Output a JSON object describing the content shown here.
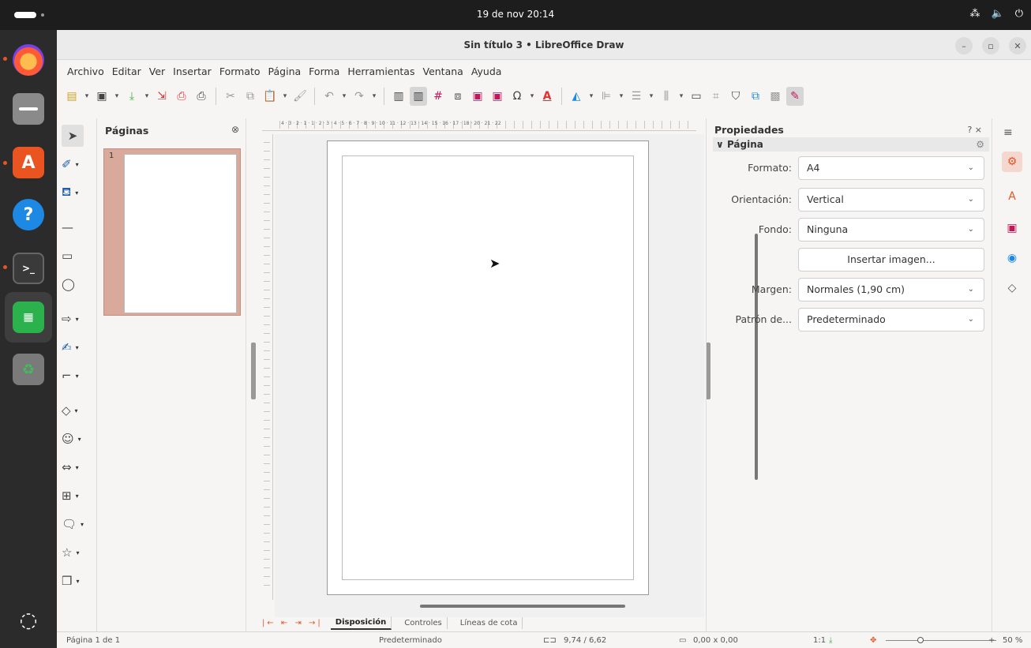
{
  "system": {
    "clock": "19 de nov  20:14",
    "tray_icons": [
      "network-icon",
      "volume-icon",
      "power-icon"
    ]
  },
  "dock": {
    "items": [
      "firefox",
      "files",
      "app-center",
      "help",
      "terminal",
      "libreoffice-calc",
      "trash",
      "show-apps"
    ]
  },
  "window": {
    "title": "Sin título 3 • LibreOffice Draw"
  },
  "menubar": {
    "items": [
      "Archivo",
      "Editar",
      "Ver",
      "Insertar",
      "Formato",
      "Página",
      "Forma",
      "Herramientas",
      "Ventana",
      "Ayuda"
    ]
  },
  "pages_panel": {
    "title": "Páginas",
    "page_number": "1"
  },
  "tabs": {
    "items": [
      "Disposición",
      "Controles",
      "Líneas de cota"
    ],
    "active": "Disposición"
  },
  "properties": {
    "title": "Propiedades",
    "controls": "? ×",
    "section": "Página",
    "format_label": "Formato:",
    "format_value": "A4",
    "orientation_label": "Orientación:",
    "orientation_value": "Vertical",
    "background_label": "Fondo:",
    "background_value": "Ninguna",
    "insert_image_label": "Insertar imagen...",
    "margin_label": "Margen:",
    "margin_value": "Normales (1,90 cm)",
    "pattern_label": "Patrón de...",
    "pattern_value": "Predeterminado"
  },
  "statusbar": {
    "page": "Página 1 de 1",
    "style": "Predeterminado",
    "position": "9,74 / 6,62",
    "size": "0,00 x 0,00",
    "scale": "1:1",
    "zoom": "50 %"
  },
  "ruler": {
    "text": "4 · 3 · 2 · 1 · 1 · 2 · 3 · 4 · 5 · 6 · 7 · 8 · 9 · 10 · 11 · 12 · 13 · 14 · 15 · 16 · 17 · 18 · 20 · 21 · 22"
  },
  "colors": {
    "accent": "#e95420",
    "thumb_bg": "#d9a99b"
  }
}
